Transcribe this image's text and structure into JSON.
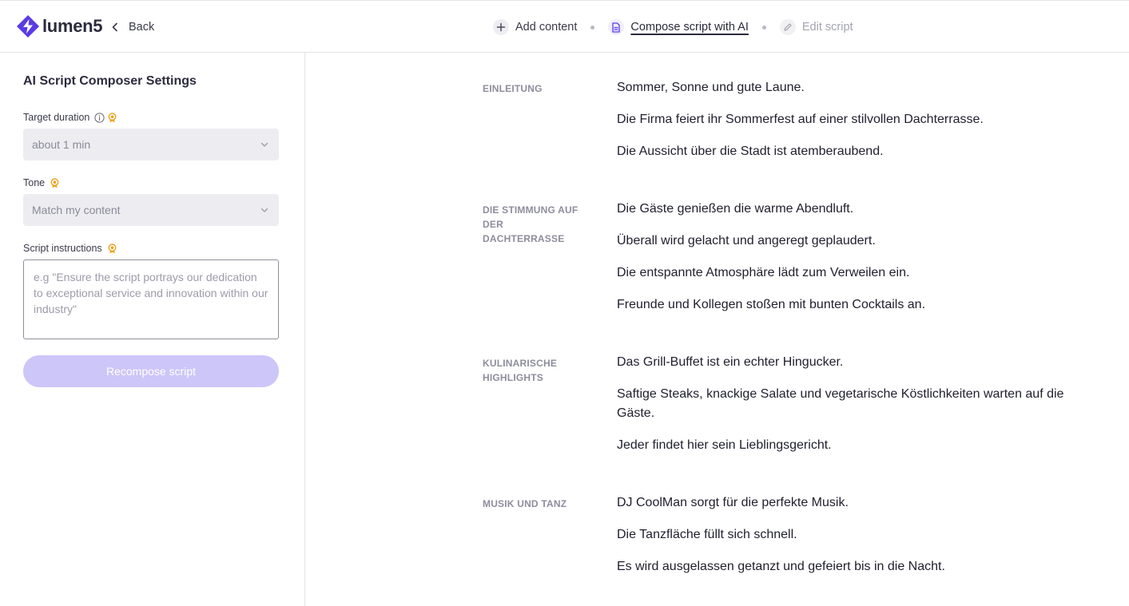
{
  "header": {
    "logo_text": "lumen5",
    "back_label": "Back",
    "steps": [
      {
        "label": "Add content",
        "icon": "plus-icon",
        "state": "default"
      },
      {
        "label": "Compose script with AI",
        "icon": "document-icon",
        "state": "active"
      },
      {
        "label": "Edit script",
        "icon": "pencil-icon",
        "state": "disabled"
      }
    ]
  },
  "sidebar": {
    "title": "AI Script Composer Settings",
    "target_duration": {
      "label": "Target duration",
      "value": "about 1 min"
    },
    "tone": {
      "label": "Tone",
      "value": "Match my content"
    },
    "script_instructions": {
      "label": "Script instructions",
      "value": "",
      "placeholder": "e.g \"Ensure the script portrays our dedication to exceptional service and innovation within our industry\""
    },
    "recompose_label": "Recompose script"
  },
  "script": {
    "sections": [
      {
        "title": "EINLEITUNG",
        "lines": [
          "Sommer, Sonne und gute Laune.",
          "Die Firma feiert ihr Sommerfest auf einer stilvollen Dachterrasse.",
          "Die Aussicht über die Stadt ist atemberaubend."
        ]
      },
      {
        "title": "DIE STIMMUNG AUF DER DACHTERRASSE",
        "lines": [
          "Die Gäste genießen die warme Abendluft.",
          "Überall wird gelacht und angeregt geplaudert.",
          "Die entspannte Atmosphäre lädt zum Verweilen ein.",
          "Freunde und Kollegen stoßen mit bunten Cocktails an."
        ]
      },
      {
        "title": "KULINARISCHE HIGHLIGHTS",
        "lines": [
          "Das Grill-Buffet ist ein echter Hingucker.",
          "Saftige Steaks, knackige Salate und vegetarische Köstlichkeiten warten auf die Gäste.",
          "Jeder findet hier sein Lieblingsgericht."
        ]
      },
      {
        "title": "MUSIK UND TANZ",
        "lines": [
          "DJ CoolMan sorgt für die perfekte Musik.",
          "Die Tanzfläche füllt sich schnell.",
          "Es wird ausgelassen getanzt und gefeiert bis in die Nacht."
        ]
      }
    ]
  },
  "colors": {
    "brand": "#5a3be5",
    "premium_badge": "#f0a11b",
    "button_disabled": "#cdc6f8"
  }
}
